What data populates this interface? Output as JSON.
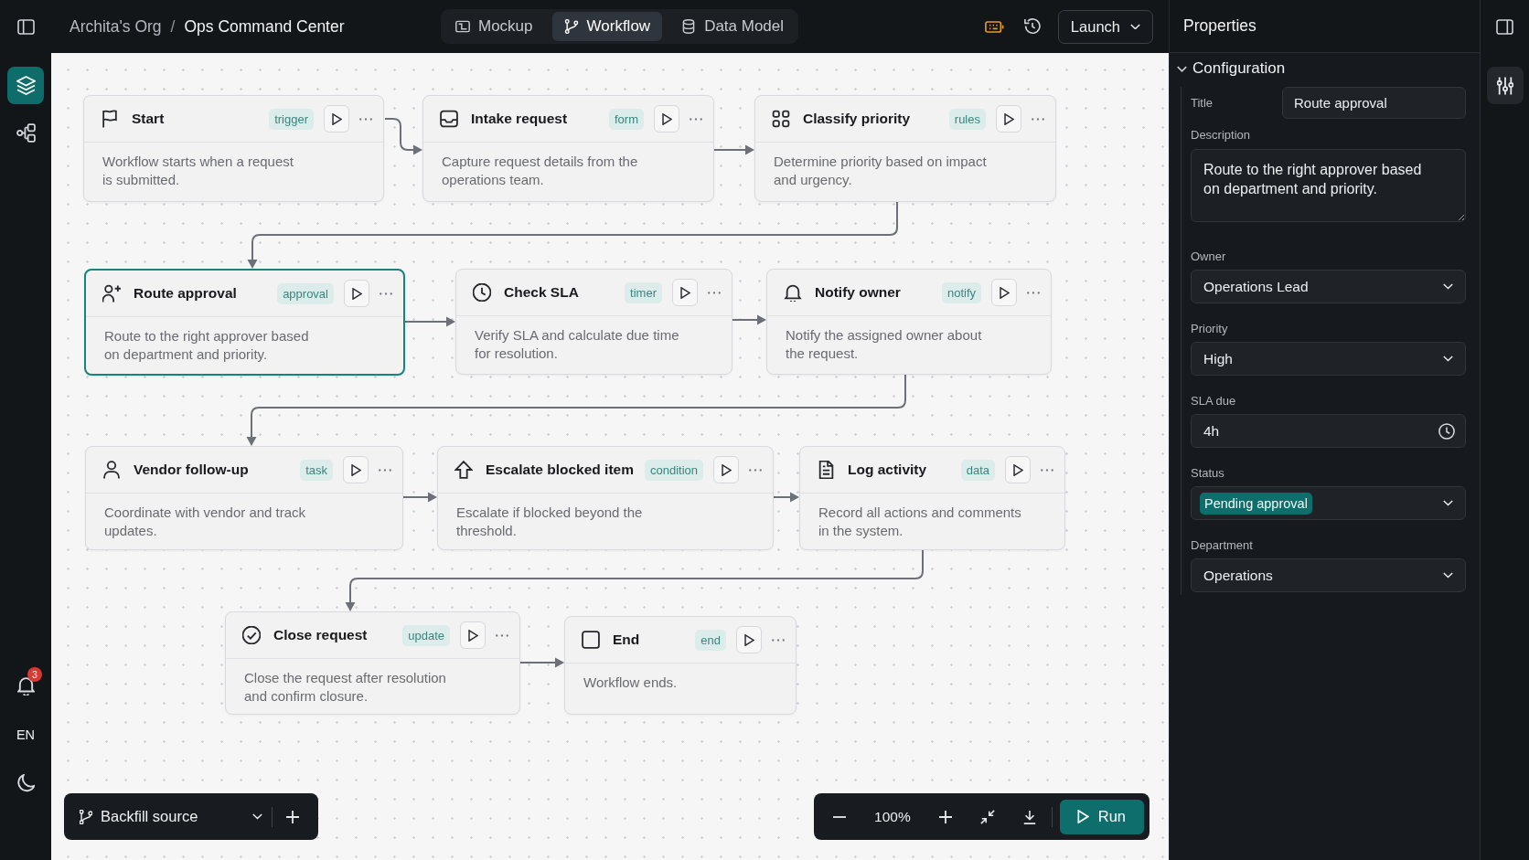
{
  "top_bar": {
    "org": "Archita's Org",
    "separator": "/",
    "project": "Ops Command Center",
    "view_tabs": [
      {
        "label": "Mockup",
        "selected": false
      },
      {
        "label": "Workflow",
        "selected": true
      },
      {
        "label": "Data Model",
        "selected": false
      }
    ],
    "launch_button": "Launch"
  },
  "left_rail": {
    "tools": [
      {
        "selected": true
      },
      {
        "selected": false
      }
    ],
    "notification_count": "3",
    "language": "EN"
  },
  "canvas": {
    "nodes": [
      {
        "title": "Start",
        "tag": "trigger",
        "description": "Workflow starts when a request\nis submitted.",
        "selected": false
      },
      {
        "title": "Intake request",
        "tag": "form",
        "description": "Capture request details from the\noperations team.",
        "selected": false
      },
      {
        "title": "Classify priority",
        "tag": "rules",
        "description": "Determine priority based on impact\nand urgency.",
        "selected": false
      },
      {
        "title": "Route approval",
        "tag": "approval",
        "description": "Route to the right approver based\non department and priority.",
        "selected": true
      },
      {
        "title": "Check SLA",
        "tag": "timer",
        "description": "Verify SLA and calculate due time\nfor resolution.",
        "selected": false
      },
      {
        "title": "Notify owner",
        "tag": "notify",
        "description": "Notify the assigned owner about\nthe request.",
        "selected": false
      },
      {
        "title": "Vendor follow-up",
        "tag": "task",
        "description": "Coordinate with vendor and track\nupdates.",
        "selected": false
      },
      {
        "title": "Escalate blocked item",
        "tag": "condition",
        "description": "Escalate if blocked beyond the\nthreshold.",
        "selected": false
      },
      {
        "title": "Log activity",
        "tag": "data",
        "description": "Record all actions and comments\nin the system.",
        "selected": false
      },
      {
        "title": "Close request",
        "tag": "update",
        "description": "Close the request after resolution\nand confirm closure.",
        "selected": false
      },
      {
        "title": "End",
        "tag": "end",
        "description": "Workflow ends.",
        "selected": false
      }
    ],
    "branch_selector": "Backfill source",
    "zoom_level": "100%",
    "run_button": "Run"
  },
  "properties_panel": {
    "title": "Properties",
    "section": {
      "title": "Configuration",
      "expanded": true,
      "fields": [
        {
          "kind": "text",
          "label": "Title",
          "value": "Route approval"
        },
        {
          "kind": "textarea",
          "label": "Description",
          "value": "Route to the right approver based on department and priority."
        },
        {
          "kind": "select",
          "label": "Owner",
          "value": "Operations Lead"
        },
        {
          "kind": "select",
          "label": "Priority",
          "value": "High"
        },
        {
          "kind": "time",
          "label": "SLA due",
          "value": "4h"
        },
        {
          "kind": "status",
          "label": "Status",
          "value": "Pending approval"
        },
        {
          "kind": "select",
          "label": "Department",
          "value": "Operations"
        }
      ]
    }
  }
}
